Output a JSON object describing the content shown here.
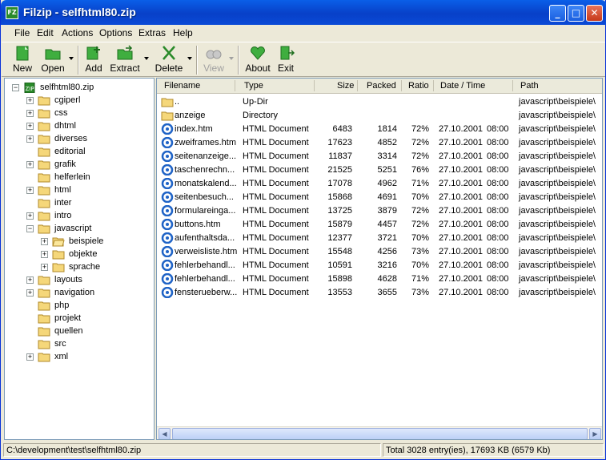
{
  "window": {
    "title": "Filzip - selfhtml80.zip",
    "min": "_",
    "max": "□",
    "close": "✕"
  },
  "menu": [
    "File",
    "Edit",
    "Actions",
    "Options",
    "Extras",
    "Help"
  ],
  "toolbar": {
    "new": "New",
    "open": "Open",
    "add": "Add",
    "extract": "Extract",
    "delete": "Delete",
    "view": "View",
    "about": "About",
    "exit": "Exit"
  },
  "tree": {
    "root": "selfhtml80.zip",
    "items": [
      {
        "label": "cgiperl"
      },
      {
        "label": "css"
      },
      {
        "label": "dhtml"
      },
      {
        "label": "diverses"
      },
      {
        "label": "editorial"
      },
      {
        "label": "grafik"
      },
      {
        "label": "helferlein"
      },
      {
        "label": "html"
      },
      {
        "label": "inter"
      },
      {
        "label": "intro"
      },
      {
        "label": "javascript"
      },
      {
        "label": "beispiele"
      },
      {
        "label": "objekte"
      },
      {
        "label": "sprache"
      },
      {
        "label": "layouts"
      },
      {
        "label": "navigation"
      },
      {
        "label": "php"
      },
      {
        "label": "projekt"
      },
      {
        "label": "quellen"
      },
      {
        "label": "src"
      },
      {
        "label": "xml"
      }
    ]
  },
  "columns": [
    "Filename",
    "Type",
    "Size",
    "Packed",
    "Ratio",
    "Date / Time",
    "Path"
  ],
  "rows": [
    {
      "name": "..",
      "type": "Up-Dir",
      "size": "",
      "packed": "",
      "ratio": "",
      "date": "",
      "time": "",
      "path": "javascript\\beispiele\\"
    },
    {
      "name": "anzeige",
      "type": "Directory",
      "size": "",
      "packed": "",
      "ratio": "",
      "date": "",
      "time": "",
      "path": "javascript\\beispiele\\"
    },
    {
      "name": "index.htm",
      "type": "HTML Document",
      "size": "6483",
      "packed": "1814",
      "ratio": "72%",
      "date": "27.10.2001",
      "time": "08:00",
      "path": "javascript\\beispiele\\"
    },
    {
      "name": "zweiframes.htm",
      "type": "HTML Document",
      "size": "17623",
      "packed": "4852",
      "ratio": "72%",
      "date": "27.10.2001",
      "time": "08:00",
      "path": "javascript\\beispiele\\"
    },
    {
      "name": "seitenanzeige...",
      "type": "HTML Document",
      "size": "11837",
      "packed": "3314",
      "ratio": "72%",
      "date": "27.10.2001",
      "time": "08:00",
      "path": "javascript\\beispiele\\"
    },
    {
      "name": "taschenrechn...",
      "type": "HTML Document",
      "size": "21525",
      "packed": "5251",
      "ratio": "76%",
      "date": "27.10.2001",
      "time": "08:00",
      "path": "javascript\\beispiele\\"
    },
    {
      "name": "monatskalend...",
      "type": "HTML Document",
      "size": "17078",
      "packed": "4962",
      "ratio": "71%",
      "date": "27.10.2001",
      "time": "08:00",
      "path": "javascript\\beispiele\\"
    },
    {
      "name": "seitenbesuch...",
      "type": "HTML Document",
      "size": "15868",
      "packed": "4691",
      "ratio": "70%",
      "date": "27.10.2001",
      "time": "08:00",
      "path": "javascript\\beispiele\\"
    },
    {
      "name": "formulareinga...",
      "type": "HTML Document",
      "size": "13725",
      "packed": "3879",
      "ratio": "72%",
      "date": "27.10.2001",
      "time": "08:00",
      "path": "javascript\\beispiele\\"
    },
    {
      "name": "buttons.htm",
      "type": "HTML Document",
      "size": "15879",
      "packed": "4457",
      "ratio": "72%",
      "date": "27.10.2001",
      "time": "08:00",
      "path": "javascript\\beispiele\\"
    },
    {
      "name": "aufenthaltsda...",
      "type": "HTML Document",
      "size": "12377",
      "packed": "3721",
      "ratio": "70%",
      "date": "27.10.2001",
      "time": "08:00",
      "path": "javascript\\beispiele\\"
    },
    {
      "name": "verweisliste.htm",
      "type": "HTML Document",
      "size": "15548",
      "packed": "4256",
      "ratio": "73%",
      "date": "27.10.2001",
      "time": "08:00",
      "path": "javascript\\beispiele\\"
    },
    {
      "name": "fehlerbehandl...",
      "type": "HTML Document",
      "size": "10591",
      "packed": "3216",
      "ratio": "70%",
      "date": "27.10.2001",
      "time": "08:00",
      "path": "javascript\\beispiele\\"
    },
    {
      "name": "fehlerbehandl...",
      "type": "HTML Document",
      "size": "15898",
      "packed": "4628",
      "ratio": "71%",
      "date": "27.10.2001",
      "time": "08:00",
      "path": "javascript\\beispiele\\"
    },
    {
      "name": "fensterueberw...",
      "type": "HTML Document",
      "size": "13553",
      "packed": "3655",
      "ratio": "73%",
      "date": "27.10.2001",
      "time": "08:00",
      "path": "javascript\\beispiele\\"
    }
  ],
  "status": {
    "path": "C:\\development\\test\\selfhtml80.zip",
    "total": "Total 3028 entry(ies), 17693 KB (6579 Kb)"
  },
  "colors": {
    "titlebar": "#0a4ad6",
    "folder": "#f5d77a",
    "html_icon": "#1f63c6"
  }
}
